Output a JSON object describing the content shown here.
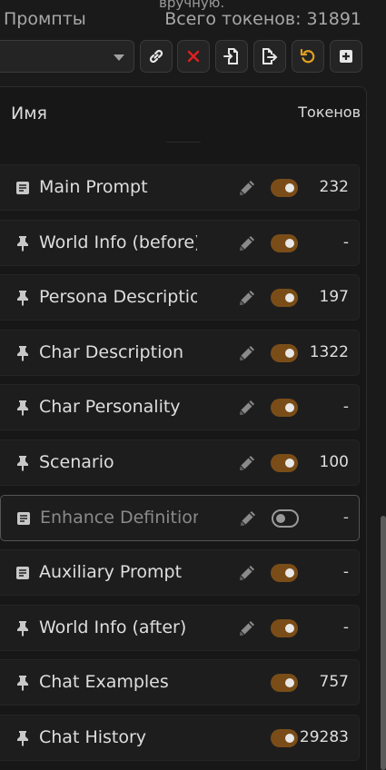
{
  "header": {
    "top_note": "вручную.",
    "title": "Промпты",
    "total_tokens": "Всего токенов: 31891"
  },
  "toolbar": {
    "buttons": [
      {
        "icon": "link-icon"
      },
      {
        "icon": "close-icon",
        "color": "#e02020"
      },
      {
        "icon": "file-import-icon"
      },
      {
        "icon": "file-export-icon"
      },
      {
        "icon": "undo-icon",
        "color": "#e0a020"
      },
      {
        "icon": "add-icon"
      }
    ]
  },
  "columns": {
    "name": "Имя",
    "tokens": "Токенов"
  },
  "colors": {
    "accent_toggle": "#7a4d18",
    "background": "#1a1a1a"
  },
  "prompts": [
    {
      "name": "Main Prompt",
      "icon": "document-icon",
      "editable": true,
      "enabled": true,
      "tokens": "232"
    },
    {
      "name": "World Info (before)",
      "icon": "pin-icon",
      "editable": true,
      "enabled": true,
      "tokens": "-"
    },
    {
      "name": "Persona Description",
      "icon": "pin-icon",
      "editable": true,
      "enabled": true,
      "tokens": "197"
    },
    {
      "name": "Char Description",
      "icon": "pin-icon",
      "editable": true,
      "enabled": true,
      "tokens": "1322"
    },
    {
      "name": "Char Personality",
      "icon": "pin-icon",
      "editable": true,
      "enabled": true,
      "tokens": "-"
    },
    {
      "name": "Scenario",
      "icon": "pin-icon",
      "editable": true,
      "enabled": true,
      "tokens": "100"
    },
    {
      "name": "Enhance Definitions",
      "icon": "document-icon",
      "editable": true,
      "enabled": false,
      "tokens": "-"
    },
    {
      "name": "Auxiliary Prompt",
      "icon": "document-icon",
      "editable": true,
      "enabled": true,
      "tokens": "-"
    },
    {
      "name": "World Info (after)",
      "icon": "pin-icon",
      "editable": true,
      "enabled": true,
      "tokens": "-"
    },
    {
      "name": "Chat Examples",
      "icon": "pin-icon",
      "editable": false,
      "enabled": true,
      "tokens": "757"
    },
    {
      "name": "Chat History",
      "icon": "pin-icon",
      "editable": false,
      "enabled": true,
      "tokens": "29283"
    }
  ]
}
